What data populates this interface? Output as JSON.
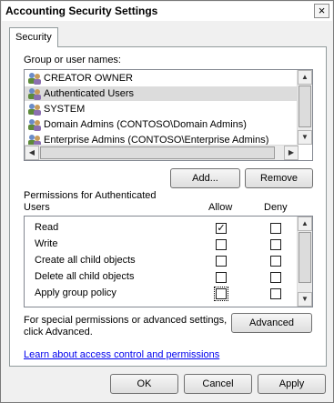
{
  "window": {
    "title": "Accounting Security Settings",
    "close_glyph": "×"
  },
  "tab": {
    "label": "Security"
  },
  "groups": {
    "label": "Group or user names:",
    "items": [
      {
        "name": "CREATOR OWNER",
        "icon": "group-icon",
        "selected": false
      },
      {
        "name": "Authenticated Users",
        "icon": "group-icon",
        "selected": true
      },
      {
        "name": "SYSTEM",
        "icon": "group-icon",
        "selected": false
      },
      {
        "name": "Domain Admins (CONTOSO\\Domain Admins)",
        "icon": "group-icon",
        "selected": false
      },
      {
        "name": "Enterprise Admins (CONTOSO\\Enterprise Admins)",
        "icon": "group-icon",
        "selected": false
      }
    ]
  },
  "buttons": {
    "add": "Add...",
    "remove": "Remove",
    "advanced": "Advanced",
    "ok": "OK",
    "cancel": "Cancel",
    "apply": "Apply"
  },
  "permissions": {
    "label_line1": "Permissions for Authenticated",
    "label_line2": "Users",
    "allow_header": "Allow",
    "deny_header": "Deny",
    "items": [
      {
        "name": "Read",
        "allow": true,
        "deny": false
      },
      {
        "name": "Write",
        "allow": false,
        "deny": false
      },
      {
        "name": "Create all child objects",
        "allow": false,
        "deny": false
      },
      {
        "name": "Delete all child objects",
        "allow": false,
        "deny": false
      },
      {
        "name": "Apply group policy",
        "allow": false,
        "deny": false
      }
    ]
  },
  "advanced_text": {
    "line1": "For special permissions or advanced settings,",
    "line2": "click Advanced."
  },
  "help_link": "Learn about access control and permissions",
  "colors": {
    "selection": "#dcdcdc",
    "link": "#0000ee",
    "dialog_bg": "#f0f0f0"
  }
}
